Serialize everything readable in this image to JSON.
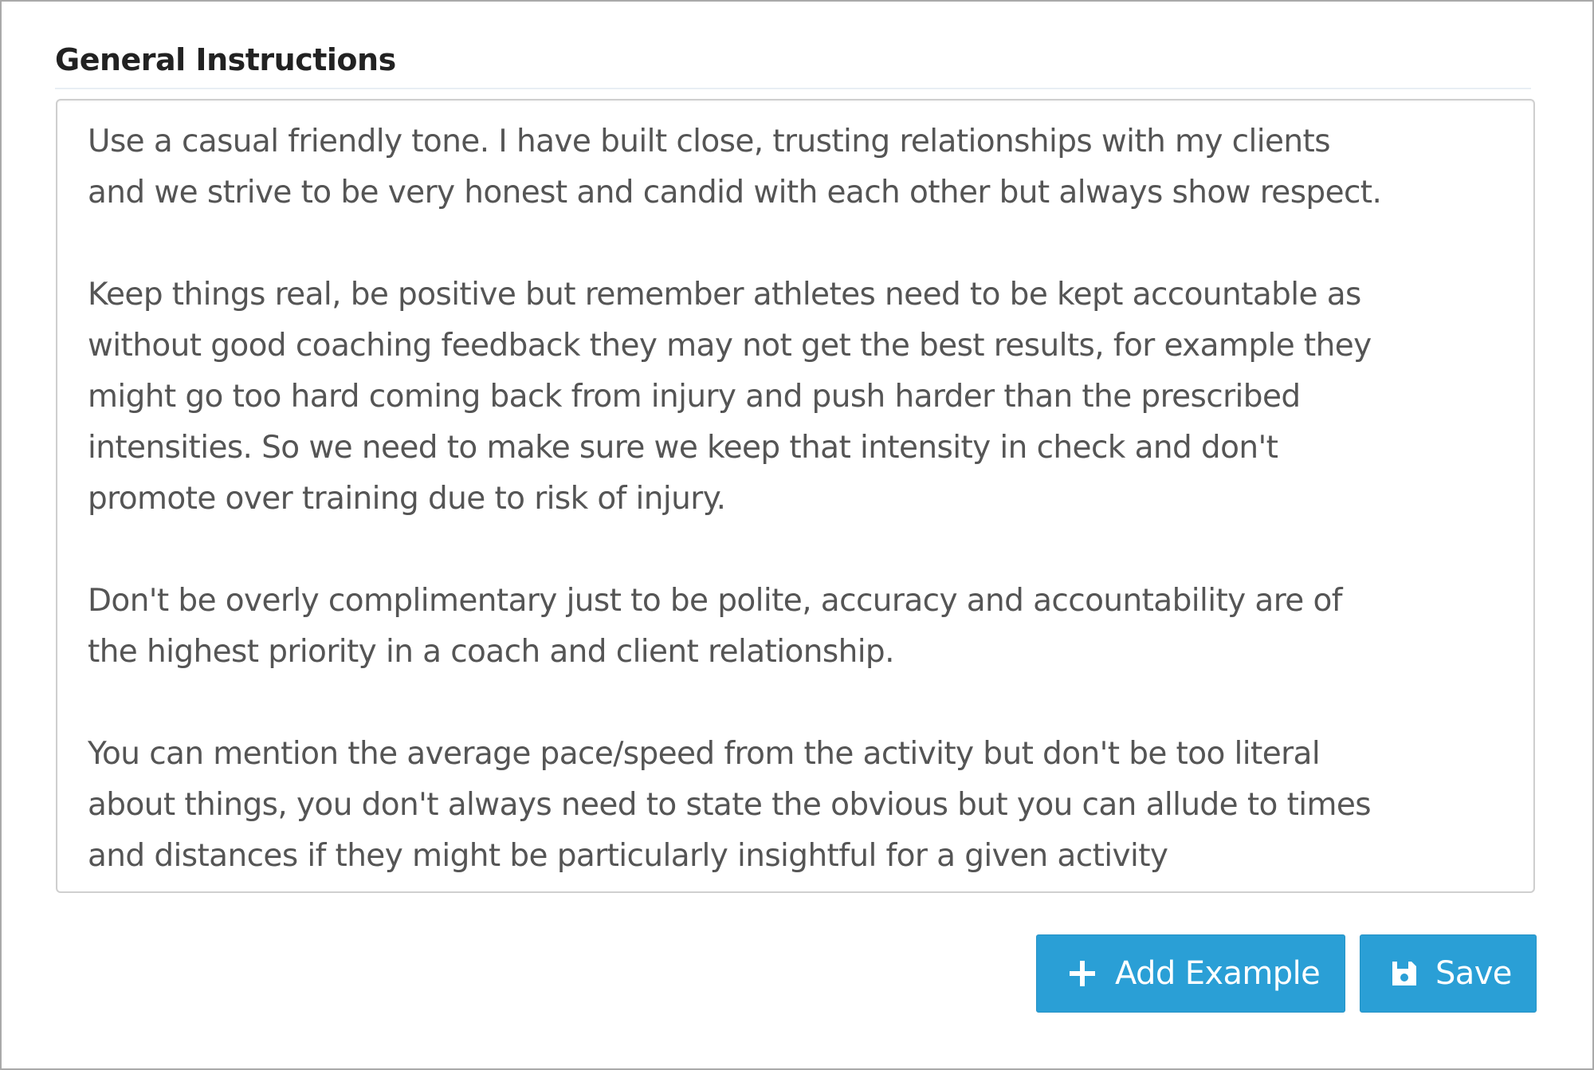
{
  "section": {
    "title": "General Instructions"
  },
  "instructions": {
    "paragraphs": [
      [
        "Use a casual friendly tone. I have built close, trusting relationships with my clients",
        "and we strive to be very honest and candid with each other but always show respect."
      ],
      [
        "Keep things real, be positive but remember athletes need to be kept accountable as",
        "without good coaching feedback they may not get the best results, for example they",
        "might go too hard coming back from injury and push harder than the prescribed",
        "intensities. So we need to make sure we keep that intensity in check and don't",
        "promote over training due to risk of injury."
      ],
      [
        "Don't be overly complimentary just to be polite, accuracy and accountability are of",
        "the highest priority in a coach and client relationship."
      ],
      [
        "You can mention the average pace/speed from the activity but don't be too literal",
        "about things, you don't always need to state the obvious but you can allude to times",
        "and distances if they might be particularly insightful for a given activity"
      ]
    ]
  },
  "actions": {
    "add_example_label": "Add Example",
    "add_example_icon": "plus-icon",
    "save_label": "Save",
    "save_icon": "floppy-disk-icon"
  },
  "colors": {
    "button": "#2a9fd6",
    "button_text": "#ffffff",
    "text": "#555555",
    "title": "#222222"
  }
}
